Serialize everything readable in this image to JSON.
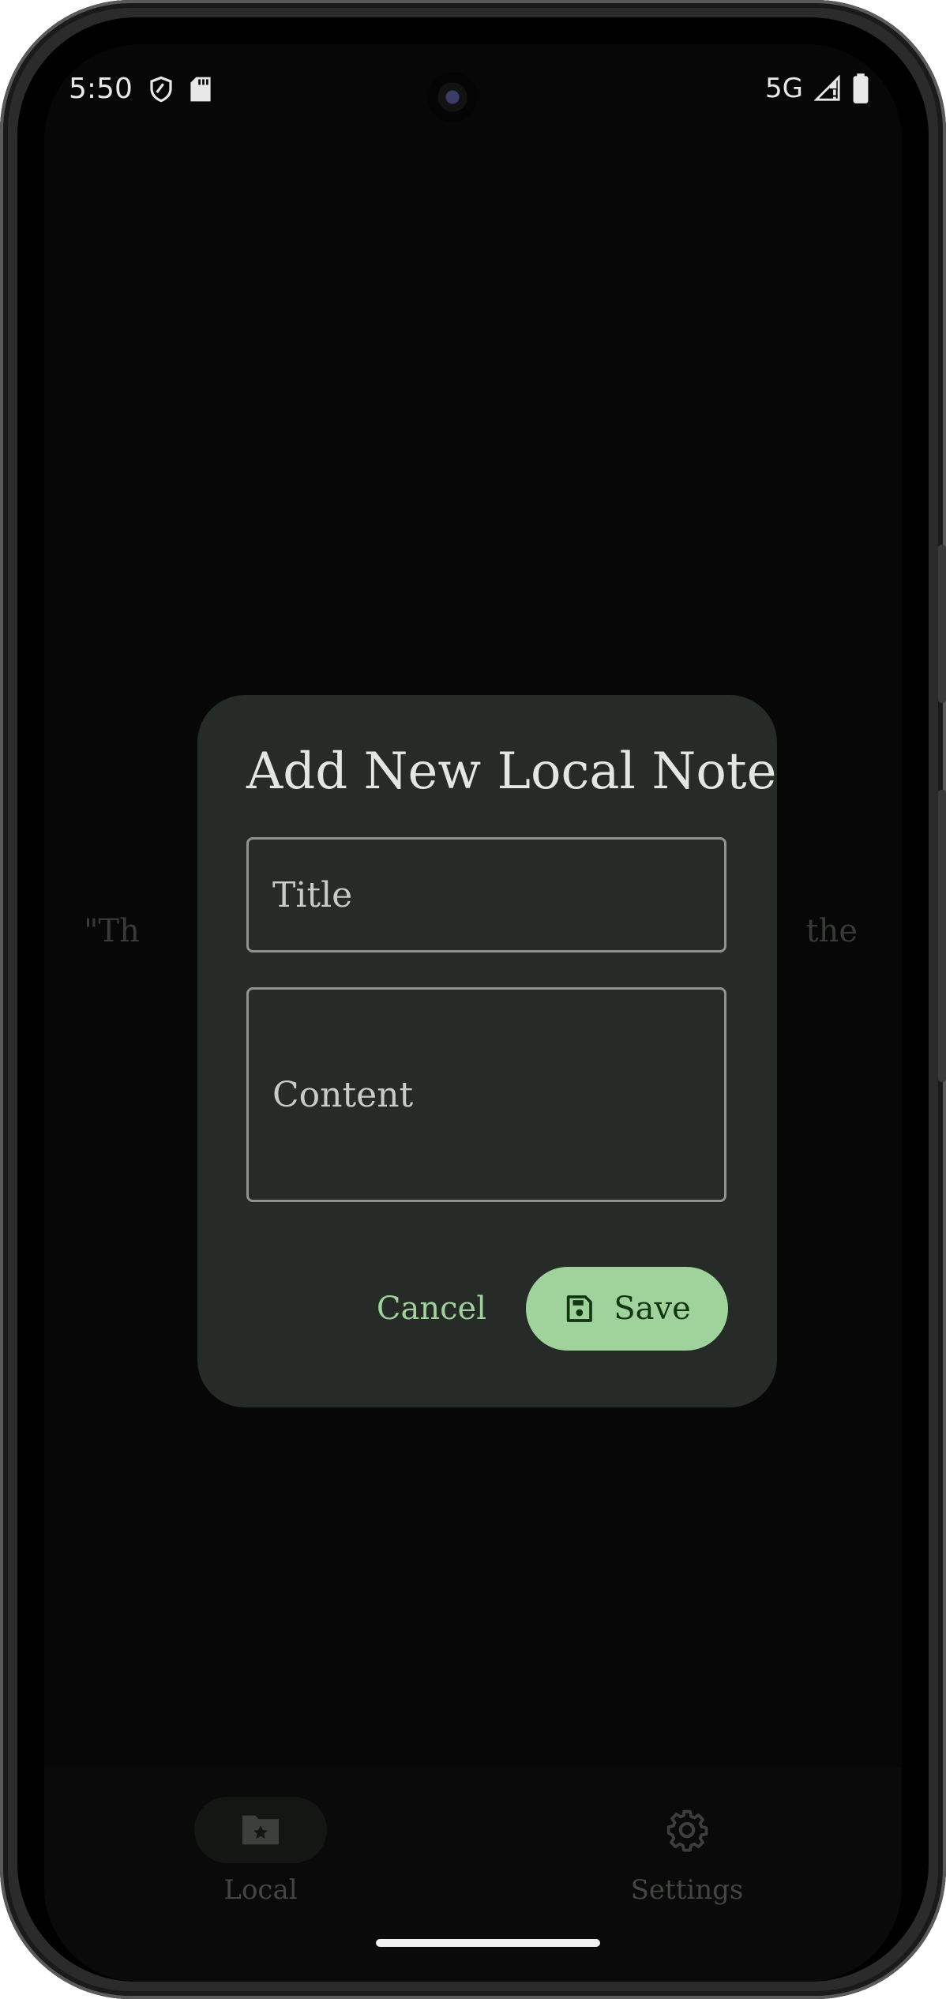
{
  "status_bar": {
    "time": "5:50",
    "network": "5G",
    "icons": [
      "shield-icon",
      "sd-card-icon",
      "signal-icon",
      "battery-icon"
    ]
  },
  "background": {
    "quote_left": "\"Th",
    "quote_right": "the"
  },
  "dialog": {
    "title": "Add New Local Note",
    "title_placeholder": "Title",
    "content_placeholder": "Content",
    "cancel_label": "Cancel",
    "save_label": "Save",
    "save_icon": "save-icon"
  },
  "nav": {
    "items": [
      {
        "label": "Local",
        "icon": "folder-star-icon",
        "active": true
      },
      {
        "label": "Settings",
        "icon": "gear-icon",
        "active": false
      }
    ]
  },
  "colors": {
    "accent": "#a0d39b",
    "dialog_bg": "#272b27",
    "app_bg": "#0a0c0a"
  }
}
